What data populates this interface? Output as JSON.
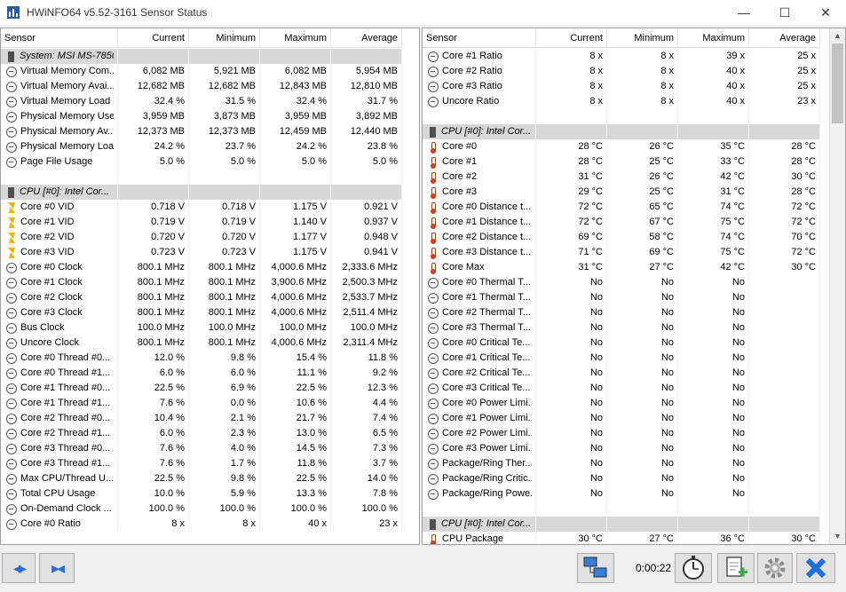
{
  "window": {
    "title": "HWiNFO64 v5.52-3161 Sensor Status",
    "minimize": "—",
    "maximize": "☐",
    "close": "✕"
  },
  "columns": {
    "sensor": "Sensor",
    "current": "Current",
    "minimum": "Minimum",
    "maximum": "Maximum",
    "average": "Average"
  },
  "left_rows": [
    {
      "type": "group",
      "icon": "chip",
      "name": "System: MSI MS-7850"
    },
    {
      "icon": "clock",
      "name": "Virtual Memory Com...",
      "cur": "6,082 MB",
      "min": "5,921 MB",
      "max": "6,082 MB",
      "avg": "5,954 MB"
    },
    {
      "icon": "clock",
      "name": "Virtual Memory Avai...",
      "cur": "12,682 MB",
      "min": "12,682 MB",
      "max": "12,843 MB",
      "avg": "12,810 MB"
    },
    {
      "icon": "clock",
      "name": "Virtual Memory Load",
      "cur": "32.4 %",
      "min": "31.5 %",
      "max": "32.4 %",
      "avg": "31.7 %"
    },
    {
      "icon": "clock",
      "name": "Physical Memory Used",
      "cur": "3,959 MB",
      "min": "3,873 MB",
      "max": "3,959 MB",
      "avg": "3,892 MB"
    },
    {
      "icon": "clock",
      "name": "Physical Memory Av...",
      "cur": "12,373 MB",
      "min": "12,373 MB",
      "max": "12,459 MB",
      "avg": "12,440 MB"
    },
    {
      "icon": "clock",
      "name": "Physical Memory Load",
      "cur": "24.2 %",
      "min": "23.7 %",
      "max": "24.2 %",
      "avg": "23.8 %"
    },
    {
      "icon": "clock",
      "name": "Page File Usage",
      "cur": "5.0 %",
      "min": "5.0 %",
      "max": "5.0 %",
      "avg": "5.0 %"
    },
    {
      "type": "blank"
    },
    {
      "type": "group",
      "icon": "chip",
      "name": "CPU [#0]: Intel Cor..."
    },
    {
      "icon": "volt",
      "name": "Core #0 VID",
      "cur": "0.718 V",
      "min": "0.718 V",
      "max": "1.175 V",
      "avg": "0.921 V"
    },
    {
      "icon": "volt",
      "name": "Core #1 VID",
      "cur": "0.719 V",
      "min": "0.719 V",
      "max": "1.140 V",
      "avg": "0.937 V"
    },
    {
      "icon": "volt",
      "name": "Core #2 VID",
      "cur": "0.720 V",
      "min": "0.720 V",
      "max": "1.177 V",
      "avg": "0.948 V"
    },
    {
      "icon": "volt",
      "name": "Core #3 VID",
      "cur": "0.723 V",
      "min": "0.723 V",
      "max": "1.175 V",
      "avg": "0.941 V"
    },
    {
      "icon": "clock",
      "name": "Core #0 Clock",
      "cur": "800.1 MHz",
      "min": "800.1 MHz",
      "max": "4,000.6 MHz",
      "avg": "2,333.6 MHz"
    },
    {
      "icon": "clock",
      "name": "Core #1 Clock",
      "cur": "800.1 MHz",
      "min": "800.1 MHz",
      "max": "3,900.6 MHz",
      "avg": "2,500.3 MHz"
    },
    {
      "icon": "clock",
      "name": "Core #2 Clock",
      "cur": "800.1 MHz",
      "min": "800.1 MHz",
      "max": "4,000.6 MHz",
      "avg": "2,533.7 MHz"
    },
    {
      "icon": "clock",
      "name": "Core #3 Clock",
      "cur": "800.1 MHz",
      "min": "800.1 MHz",
      "max": "4,000.6 MHz",
      "avg": "2,511.4 MHz"
    },
    {
      "icon": "clock",
      "name": "Bus Clock",
      "cur": "100.0 MHz",
      "min": "100.0 MHz",
      "max": "100.0 MHz",
      "avg": "100.0 MHz"
    },
    {
      "icon": "clock",
      "name": "Uncore Clock",
      "cur": "800.1 MHz",
      "min": "800.1 MHz",
      "max": "4,000.6 MHz",
      "avg": "2,311.4 MHz"
    },
    {
      "icon": "clock",
      "name": "Core #0 Thread #0...",
      "cur": "12.0 %",
      "min": "9.8 %",
      "max": "15.4 %",
      "avg": "11.8 %"
    },
    {
      "icon": "clock",
      "name": "Core #0 Thread #1...",
      "cur": "6.0 %",
      "min": "6.0 %",
      "max": "11.1 %",
      "avg": "9.2 %"
    },
    {
      "icon": "clock",
      "name": "Core #1 Thread #0...",
      "cur": "22.5 %",
      "min": "6.9 %",
      "max": "22.5 %",
      "avg": "12.3 %"
    },
    {
      "icon": "clock",
      "name": "Core #1 Thread #1...",
      "cur": "7.6 %",
      "min": "0.0 %",
      "max": "10.6 %",
      "avg": "4.4 %"
    },
    {
      "icon": "clock",
      "name": "Core #2 Thread #0...",
      "cur": "10.4 %",
      "min": "2.1 %",
      "max": "21.7 %",
      "avg": "7.4 %"
    },
    {
      "icon": "clock",
      "name": "Core #2 Thread #1...",
      "cur": "6.0 %",
      "min": "2.3 %",
      "max": "13.0 %",
      "avg": "6.5 %"
    },
    {
      "icon": "clock",
      "name": "Core #3 Thread #0...",
      "cur": "7.6 %",
      "min": "4.0 %",
      "max": "14.5 %",
      "avg": "7.3 %"
    },
    {
      "icon": "clock",
      "name": "Core #3 Thread #1...",
      "cur": "7.6 %",
      "min": "1.7 %",
      "max": "11.8 %",
      "avg": "3.7 %"
    },
    {
      "icon": "clock",
      "name": "Max CPU/Thread U...",
      "cur": "22.5 %",
      "min": "9.8 %",
      "max": "22.5 %",
      "avg": "14.0 %"
    },
    {
      "icon": "clock",
      "name": "Total CPU Usage",
      "cur": "10.0 %",
      "min": "5.9 %",
      "max": "13.3 %",
      "avg": "7.8 %"
    },
    {
      "icon": "clock",
      "name": "On-Demand Clock ...",
      "cur": "100.0 %",
      "min": "100.0 %",
      "max": "100.0 %",
      "avg": "100.0 %"
    },
    {
      "icon": "clock",
      "name": "Core #0 Ratio",
      "cur": "8 x",
      "min": "8 x",
      "max": "40 x",
      "avg": "23 x"
    }
  ],
  "right_rows": [
    {
      "icon": "clock",
      "name": "Core #1 Ratio",
      "cur": "8 x",
      "min": "8 x",
      "max": "39 x",
      "avg": "25 x"
    },
    {
      "icon": "clock",
      "name": "Core #2 Ratio",
      "cur": "8 x",
      "min": "8 x",
      "max": "40 x",
      "avg": "25 x"
    },
    {
      "icon": "clock",
      "name": "Core #3 Ratio",
      "cur": "8 x",
      "min": "8 x",
      "max": "40 x",
      "avg": "25 x"
    },
    {
      "icon": "clock",
      "name": "Uncore Ratio",
      "cur": "8 x",
      "min": "8 x",
      "max": "40 x",
      "avg": "23 x"
    },
    {
      "type": "blank"
    },
    {
      "type": "group",
      "icon": "chip",
      "name": "CPU [#0]: Intel Cor..."
    },
    {
      "icon": "temp",
      "name": "Core #0",
      "cur": "28 °C",
      "min": "26 °C",
      "max": "35 °C",
      "avg": "28 °C"
    },
    {
      "icon": "temp",
      "name": "Core #1",
      "cur": "28 °C",
      "min": "25 °C",
      "max": "33 °C",
      "avg": "28 °C"
    },
    {
      "icon": "temp",
      "name": "Core #2",
      "cur": "31 °C",
      "min": "26 °C",
      "max": "42 °C",
      "avg": "30 °C"
    },
    {
      "icon": "temp",
      "name": "Core #3",
      "cur": "29 °C",
      "min": "25 °C",
      "max": "31 °C",
      "avg": "28 °C"
    },
    {
      "icon": "temp",
      "name": "Core #0 Distance t...",
      "cur": "72 °C",
      "min": "65 °C",
      "max": "74 °C",
      "avg": "72 °C"
    },
    {
      "icon": "temp",
      "name": "Core #1 Distance t...",
      "cur": "72 °C",
      "min": "67 °C",
      "max": "75 °C",
      "avg": "72 °C"
    },
    {
      "icon": "temp",
      "name": "Core #2 Distance t...",
      "cur": "69 °C",
      "min": "58 °C",
      "max": "74 °C",
      "avg": "70 °C"
    },
    {
      "icon": "temp",
      "name": "Core #3 Distance t...",
      "cur": "71 °C",
      "min": "69 °C",
      "max": "75 °C",
      "avg": "72 °C"
    },
    {
      "icon": "temp",
      "name": "Core Max",
      "cur": "31 °C",
      "min": "27 °C",
      "max": "42 °C",
      "avg": "30 °C"
    },
    {
      "icon": "clock",
      "name": "Core #0 Thermal T...",
      "cur": "No",
      "min": "No",
      "max": "No",
      "avg": ""
    },
    {
      "icon": "clock",
      "name": "Core #1 Thermal T...",
      "cur": "No",
      "min": "No",
      "max": "No",
      "avg": ""
    },
    {
      "icon": "clock",
      "name": "Core #2 Thermal T...",
      "cur": "No",
      "min": "No",
      "max": "No",
      "avg": ""
    },
    {
      "icon": "clock",
      "name": "Core #3 Thermal T...",
      "cur": "No",
      "min": "No",
      "max": "No",
      "avg": ""
    },
    {
      "icon": "clock",
      "name": "Core #0 Critical Te...",
      "cur": "No",
      "min": "No",
      "max": "No",
      "avg": ""
    },
    {
      "icon": "clock",
      "name": "Core #1 Critical Te...",
      "cur": "No",
      "min": "No",
      "max": "No",
      "avg": ""
    },
    {
      "icon": "clock",
      "name": "Core #2 Critical Te...",
      "cur": "No",
      "min": "No",
      "max": "No",
      "avg": ""
    },
    {
      "icon": "clock",
      "name": "Core #3 Critical Te...",
      "cur": "No",
      "min": "No",
      "max": "No",
      "avg": ""
    },
    {
      "icon": "clock",
      "name": "Core #0 Power Limi...",
      "cur": "No",
      "min": "No",
      "max": "No",
      "avg": ""
    },
    {
      "icon": "clock",
      "name": "Core #1 Power Limi...",
      "cur": "No",
      "min": "No",
      "max": "No",
      "avg": ""
    },
    {
      "icon": "clock",
      "name": "Core #2 Power Limi...",
      "cur": "No",
      "min": "No",
      "max": "No",
      "avg": ""
    },
    {
      "icon": "clock",
      "name": "Core #3 Power Limi...",
      "cur": "No",
      "min": "No",
      "max": "No",
      "avg": ""
    },
    {
      "icon": "clock",
      "name": "Package/Ring Ther...",
      "cur": "No",
      "min": "No",
      "max": "No",
      "avg": ""
    },
    {
      "icon": "clock",
      "name": "Package/Ring Critic...",
      "cur": "No",
      "min": "No",
      "max": "No",
      "avg": ""
    },
    {
      "icon": "clock",
      "name": "Package/Ring Powe...",
      "cur": "No",
      "min": "No",
      "max": "No",
      "avg": ""
    },
    {
      "type": "blank"
    },
    {
      "type": "group",
      "icon": "chip",
      "name": "CPU [#0]: Intel Cor..."
    },
    {
      "icon": "temp",
      "name": "CPU Package",
      "cur": "30 °C",
      "min": "27 °C",
      "max": "36 °C",
      "avg": "30 °C"
    }
  ],
  "scroll": {
    "up": "▲",
    "down": "▼"
  },
  "toolbar": {
    "nav_left": "◂▸",
    "nav_right": "▸◂",
    "elapsed_time": "0:00:22"
  }
}
